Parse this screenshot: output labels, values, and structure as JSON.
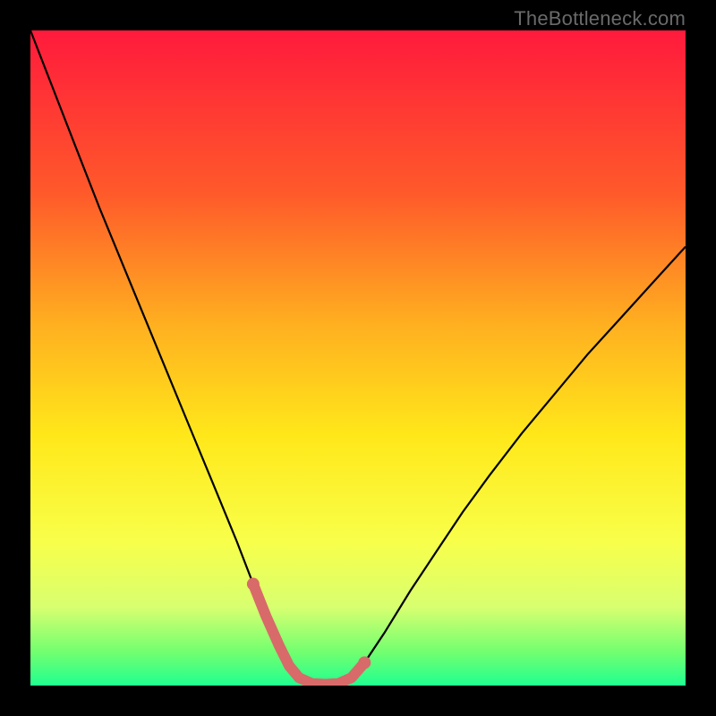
{
  "watermark": "TheBottleneck.com",
  "colors": {
    "frame": "#000000",
    "gradient_top": "#ff1a3c",
    "gradient_bottom": "#20ff90",
    "curve_stroke": "#000000",
    "highlight_stroke": "#d86a6a"
  },
  "chart_data": {
    "type": "line",
    "title": "",
    "xlabel": "",
    "ylabel": "",
    "xlim": [
      0,
      100
    ],
    "ylim": [
      0,
      100
    ],
    "grid": false,
    "note": "No numeric axis ticks are visible; x is horizontal position (0-100), y is bottleneck percentage (0 at bottom green, 100 at top red). Values are estimated from pixel positions.",
    "series": [
      {
        "name": "bottleneck-curve",
        "x": [
          0.0,
          3.5,
          7.0,
          10.5,
          14.0,
          17.5,
          21.0,
          24.5,
          28.0,
          31.5,
          34.0,
          36.0,
          38.0,
          39.5,
          41.0,
          43.0,
          45.0,
          47.0,
          49.0,
          51.0,
          54.0,
          58.0,
          62.0,
          66.0,
          70.0,
          75.0,
          80.0,
          85.0,
          90.0,
          95.0,
          100.0
        ],
        "y": [
          100.0,
          91.0,
          82.0,
          73.0,
          64.5,
          56.0,
          47.5,
          39.0,
          30.5,
          22.0,
          15.5,
          10.5,
          6.0,
          3.0,
          1.2,
          0.3,
          0.2,
          0.3,
          1.2,
          3.5,
          8.0,
          14.5,
          20.5,
          26.5,
          32.0,
          38.5,
          44.5,
          50.5,
          56.0,
          61.5,
          67.0
        ]
      }
    ],
    "highlight": {
      "name": "optimal-range",
      "x_range": [
        34.0,
        51.0
      ],
      "y_max": 15.0
    }
  }
}
